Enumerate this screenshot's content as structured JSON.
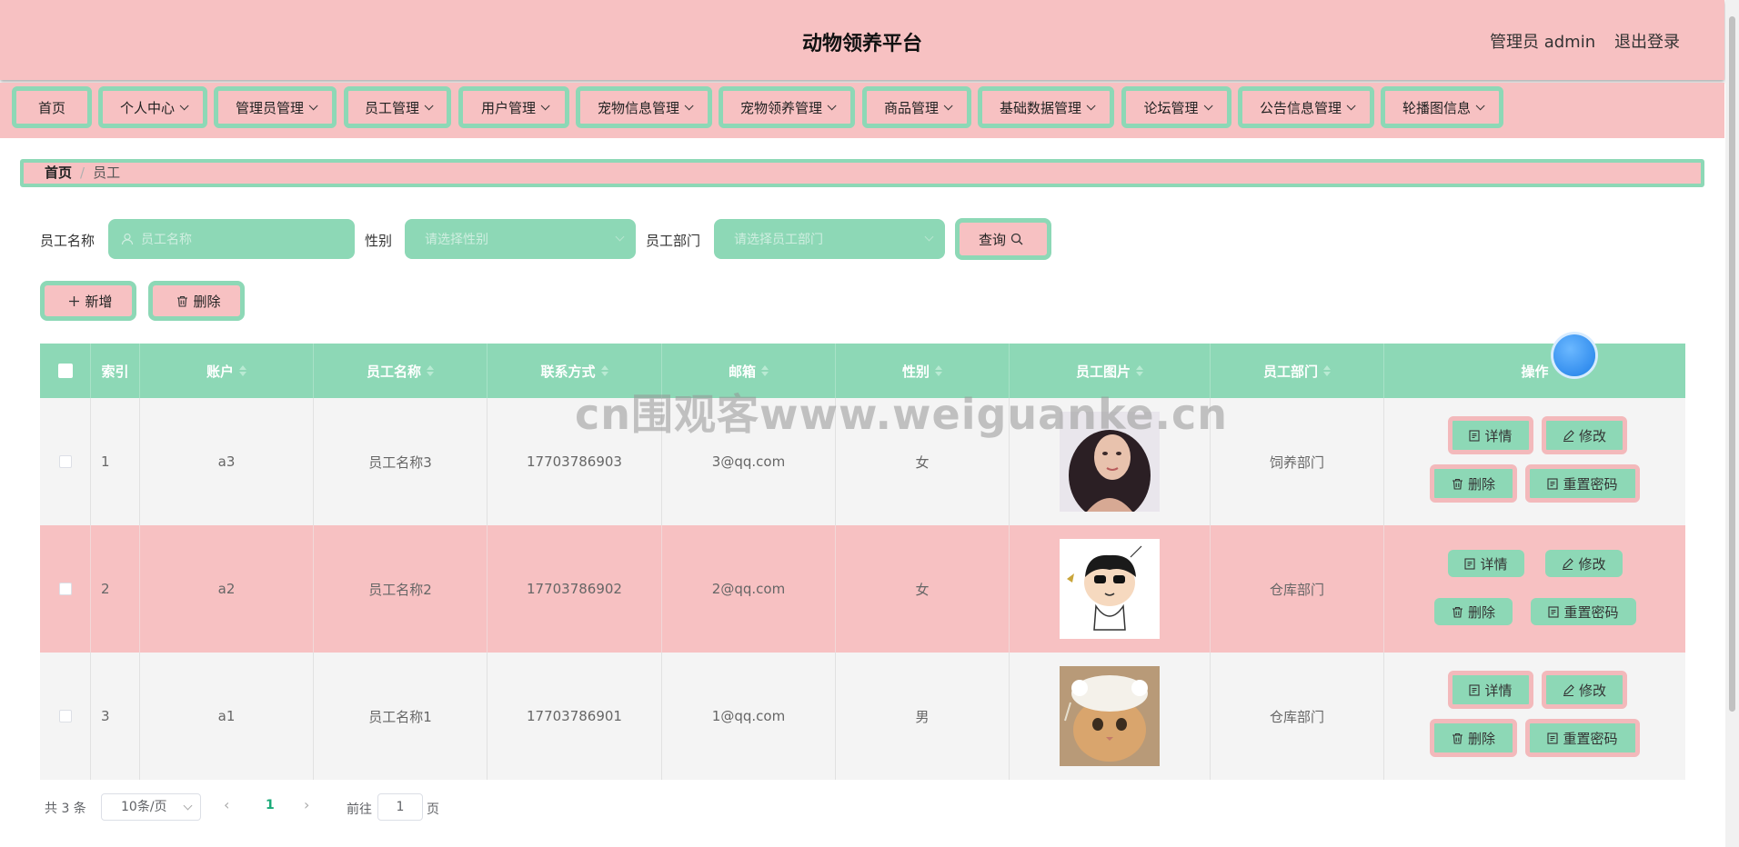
{
  "header": {
    "title": "动物领养平台",
    "user_label": "管理员 admin",
    "logout_label": "退出登录"
  },
  "nav": {
    "items": [
      {
        "label": "首页"
      },
      {
        "label": "个人中心"
      },
      {
        "label": "管理员管理"
      },
      {
        "label": "员工管理"
      },
      {
        "label": "用户管理"
      },
      {
        "label": "宠物信息管理"
      },
      {
        "label": "宠物领养管理"
      },
      {
        "label": "商品管理"
      },
      {
        "label": "基础数据管理"
      },
      {
        "label": "论坛管理"
      },
      {
        "label": "公告信息管理"
      },
      {
        "label": "轮播图信息"
      }
    ]
  },
  "breadcrumb": {
    "home": "首页",
    "separator": "/",
    "current": "员工"
  },
  "search": {
    "name_label": "员工名称",
    "name_placeholder": "员工名称",
    "gender_label": "性别",
    "gender_placeholder": "请选择性别",
    "dept_label": "员工部门",
    "dept_placeholder": "请选择员工部门",
    "query_label": "查询"
  },
  "toolbar": {
    "add_label": "新增",
    "delete_label": "删除"
  },
  "table": {
    "headers": {
      "index": "索引",
      "account": "账户",
      "name": "员工名称",
      "phone": "联系方式",
      "email": "邮箱",
      "gender": "性别",
      "photo": "员工图片",
      "dept": "员工部门",
      "actions": "操作"
    },
    "rows": [
      {
        "index": "1",
        "account": "a3",
        "name": "员工名称3",
        "phone": "17703786903",
        "email": "3@qq.com",
        "gender": "女",
        "dept": "饲养部门"
      },
      {
        "index": "2",
        "account": "a2",
        "name": "员工名称2",
        "phone": "17703786902",
        "email": "2@qq.com",
        "gender": "女",
        "dept": "仓库部门"
      },
      {
        "index": "3",
        "account": "a1",
        "name": "员工名称1",
        "phone": "17703786901",
        "email": "1@qq.com",
        "gender": "男",
        "dept": "仓库部门"
      }
    ],
    "action_labels": {
      "detail": "详情",
      "edit": "修改",
      "delete": "删除",
      "reset": "重置密码"
    }
  },
  "pagination": {
    "total": "共 3 条",
    "page_size": "10条/页",
    "current_page": "1",
    "goto_prefix": "前往",
    "goto_value": "1",
    "goto_suffix": "页"
  },
  "watermark": "cn围观客www.weiguanke.cn",
  "colors": {
    "pink": "#f7c1c2",
    "mint": "#8dd8b6"
  }
}
